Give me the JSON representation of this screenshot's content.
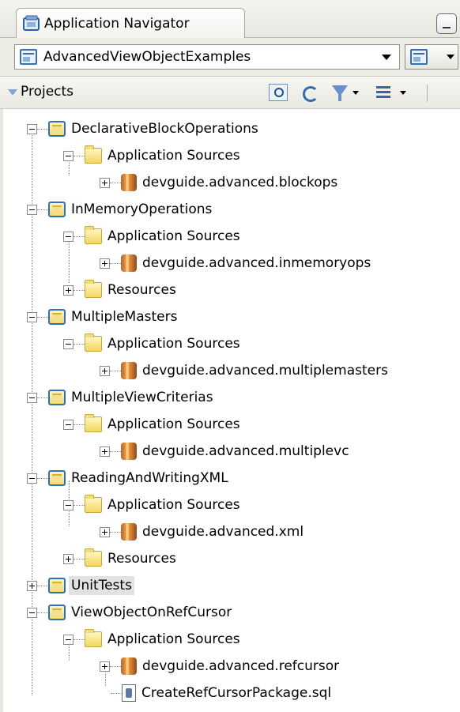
{
  "window": {
    "tab_title": "Application Navigator"
  },
  "app_selector": {
    "selected_application": "AdvancedViewObjectExamples"
  },
  "projects_panel": {
    "title": "Projects"
  },
  "tree": {
    "projects": [
      {
        "name": "DeclarativeBlockOperations",
        "children": [
          {
            "name": "Application Sources",
            "children": [
              {
                "name": "devguide.advanced.blockops"
              }
            ]
          }
        ]
      },
      {
        "name": "InMemoryOperations",
        "children": [
          {
            "name": "Application Sources",
            "children": [
              {
                "name": "devguide.advanced.inmemoryops"
              }
            ]
          },
          {
            "name": "Resources"
          }
        ]
      },
      {
        "name": "MultipleMasters",
        "children": [
          {
            "name": "Application Sources",
            "children": [
              {
                "name": "devguide.advanced.multiplemasters"
              }
            ]
          }
        ]
      },
      {
        "name": "MultipleViewCriterias",
        "children": [
          {
            "name": "Application Sources",
            "children": [
              {
                "name": "devguide.advanced.multiplevc"
              }
            ]
          }
        ]
      },
      {
        "name": "ReadingAndWritingXML",
        "children": [
          {
            "name": "Application Sources",
            "children": [
              {
                "name": "devguide.advanced.xml"
              }
            ]
          },
          {
            "name": "Resources"
          }
        ]
      },
      {
        "name": "UnitTests",
        "selected": true
      },
      {
        "name": "ViewObjectOnRefCursor",
        "children": [
          {
            "name": "Application Sources",
            "children": [
              {
                "name": "devguide.advanced.refcursor"
              },
              {
                "name": "CreateRefCursorPackage.sql"
              }
            ]
          }
        ]
      }
    ]
  }
}
